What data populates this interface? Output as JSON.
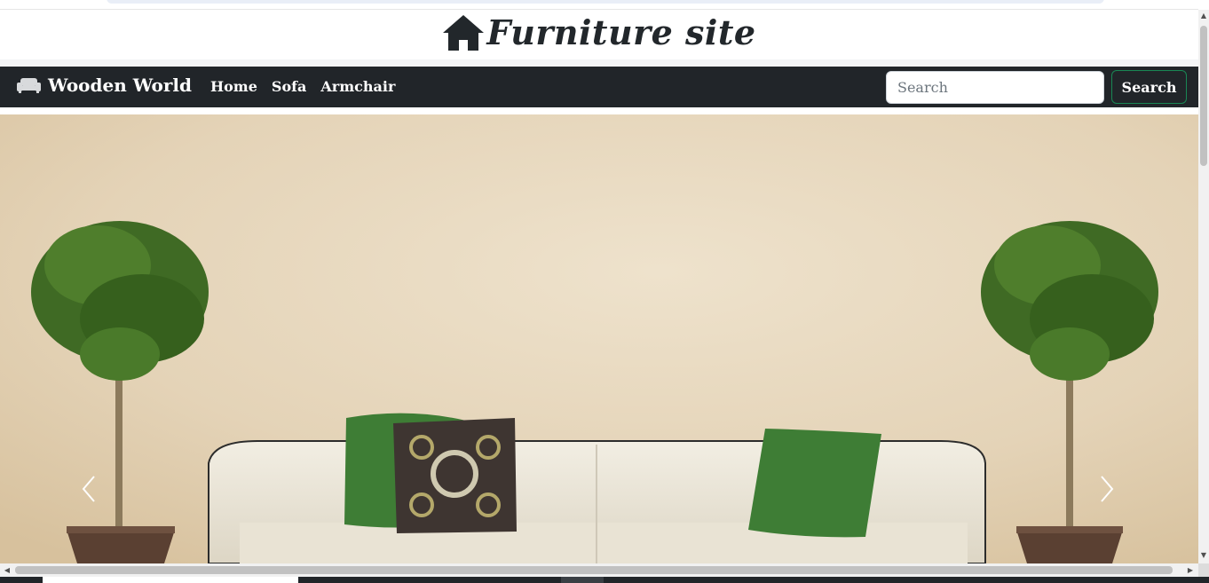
{
  "site": {
    "title": "Furniture site",
    "title_icon": "house-icon"
  },
  "navbar": {
    "brand_icon": "sofa-icon",
    "brand_label": "Wooden World",
    "links": [
      "Home",
      "Sofa",
      "Armchair"
    ],
    "search_placeholder": "Search",
    "search_button": "Search"
  },
  "carousel": {
    "prev_icon": "chevron-left-icon",
    "next_icon": "chevron-right-icon"
  },
  "colors": {
    "navbar_bg": "#212529",
    "search_button_border": "#198754",
    "title_text": "#22272b"
  }
}
